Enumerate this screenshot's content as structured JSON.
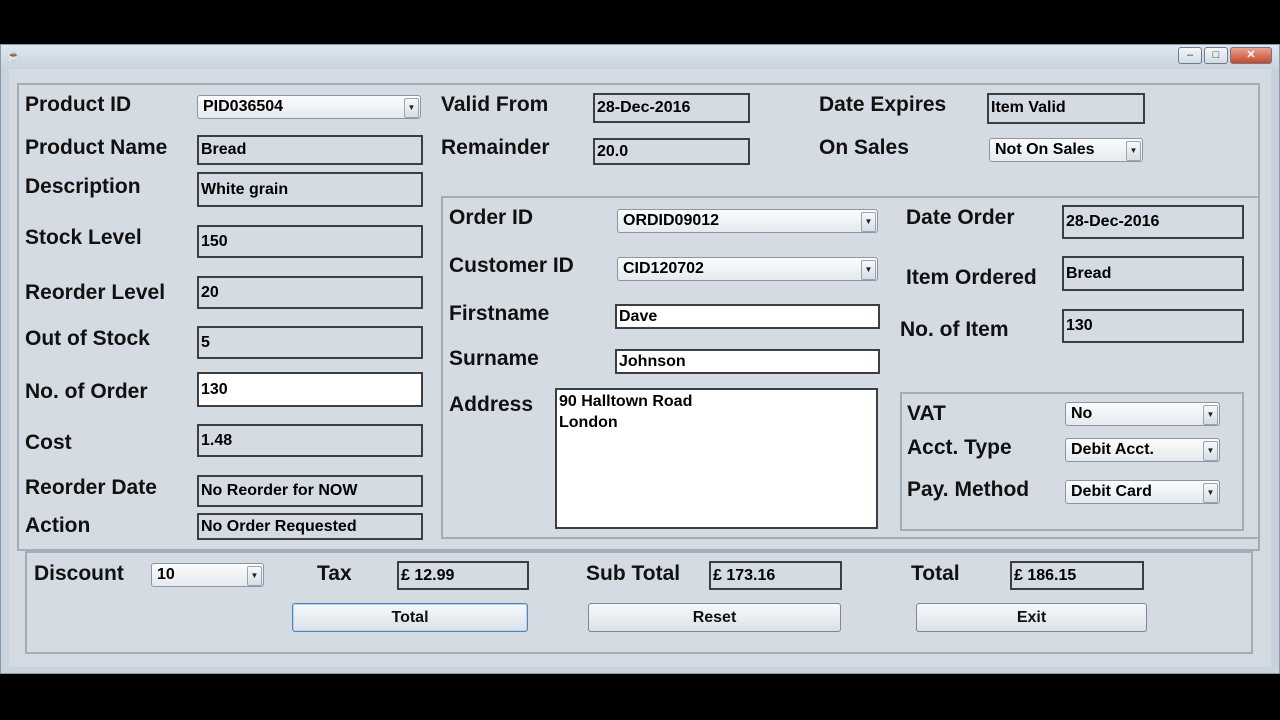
{
  "window": {
    "title": "",
    "buttons": {
      "minimize": "–",
      "maximize": "□",
      "close": "✕"
    }
  },
  "product": {
    "product_id_label": "Product ID",
    "product_id": "PID036504",
    "product_name_label": "Product Name",
    "product_name": "Bread",
    "description_label": "Description",
    "description": "White grain",
    "stock_level_label": "Stock Level",
    "stock_level": "150",
    "reorder_level_label": "Reorder Level",
    "reorder_level": "20",
    "out_of_stock_label": "Out of Stock",
    "out_of_stock": "5",
    "no_of_order_label": "No. of Order",
    "no_of_order": "130",
    "cost_label": "Cost",
    "cost": "1.48",
    "reorder_date_label": "Reorder Date",
    "reorder_date": "No Reorder for NOW",
    "action_label": "Action",
    "action": "No Order Requested",
    "valid_from_label": "Valid From",
    "valid_from": "28-Dec-2016",
    "remainder_label": "Remainder",
    "remainder": "20.0",
    "date_expires_label": "Date Expires",
    "date_expires": "Item Valid",
    "on_sales_label": "On Sales",
    "on_sales": "Not On Sales"
  },
  "order": {
    "order_id_label": "Order ID",
    "order_id": "ORDID09012",
    "customer_id_label": "Customer ID",
    "customer_id": "CID120702",
    "firstname_label": "Firstname",
    "firstname": "Dave",
    "surname_label": "Surname",
    "surname": "Johnson",
    "address_label": "Address",
    "address_line1": "90 Halltown Road",
    "address_line2": "London",
    "date_order_label": "Date Order",
    "date_order": "28-Dec-2016",
    "item_ordered_label": "Item Ordered",
    "item_ordered": "Bread",
    "no_of_item_label": "No. of Item",
    "no_of_item": "130"
  },
  "payment": {
    "vat_label": "VAT",
    "vat": "No",
    "acct_type_label": "Acct. Type",
    "acct_type": "Debit Acct.",
    "pay_method_label": "Pay. Method",
    "pay_method": "Debit Card"
  },
  "totals": {
    "discount_label": "Discount",
    "discount": "10",
    "tax_label": "Tax",
    "tax": "£ 12.99",
    "subtotal_label": "Sub Total",
    "subtotal": "£ 173.16",
    "total_label": "Total",
    "total": "£ 186.15"
  },
  "actions": {
    "total_button": "Total",
    "reset_button": "Reset",
    "exit_button": "Exit"
  },
  "icons": {
    "combo_arrow": "▼",
    "app_icon": "☕"
  }
}
